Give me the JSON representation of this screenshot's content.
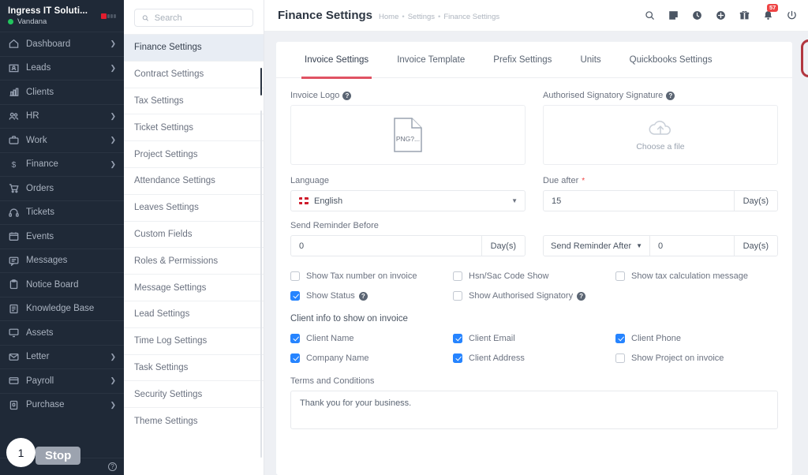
{
  "sidebar": {
    "brand": {
      "name": "Ingress IT Soluti...",
      "user": "Vandana",
      "logo_icon": "logo-mark"
    },
    "items": [
      {
        "label": "Dashboard",
        "icon": "home-icon",
        "chevron": true
      },
      {
        "label": "Leads",
        "icon": "id-card-icon",
        "chevron": true
      },
      {
        "label": "Clients",
        "icon": "bar-chart-icon",
        "chevron": false
      },
      {
        "label": "HR",
        "icon": "users-icon",
        "chevron": true
      },
      {
        "label": "Work",
        "icon": "briefcase-icon",
        "chevron": true
      },
      {
        "label": "Finance",
        "icon": "dollar-icon",
        "chevron": true
      },
      {
        "label": "Orders",
        "icon": "cart-icon",
        "chevron": false
      },
      {
        "label": "Tickets",
        "icon": "headset-icon",
        "chevron": false
      },
      {
        "label": "Events",
        "icon": "calendar-icon",
        "chevron": false
      },
      {
        "label": "Messages",
        "icon": "chat-icon",
        "chevron": false
      },
      {
        "label": "Notice Board",
        "icon": "clipboard-icon",
        "chevron": false
      },
      {
        "label": "Knowledge Base",
        "icon": "book-icon",
        "chevron": false
      },
      {
        "label": "Assets",
        "icon": "monitor-icon",
        "chevron": false
      },
      {
        "label": "Letter",
        "icon": "envelope-icon",
        "chevron": true
      },
      {
        "label": "Payroll",
        "icon": "wallet-icon",
        "chevron": true
      },
      {
        "label": "Purchase",
        "icon": "bag-icon",
        "chevron": true
      }
    ],
    "footer_icon": "help-icon"
  },
  "overlay": {
    "step_number": "1",
    "stop_label": "Stop"
  },
  "settings_nav": {
    "search": {
      "placeholder": "Search",
      "value": "",
      "icon": "search-icon"
    },
    "items": [
      "Finance Settings",
      "Contract Settings",
      "Tax Settings",
      "Ticket Settings",
      "Project Settings",
      "Attendance Settings",
      "Leaves Settings",
      "Custom Fields",
      "Roles & Permissions",
      "Message Settings",
      "Lead Settings",
      "Time Log Settings",
      "Task Settings",
      "Security Settings",
      "Theme Settings"
    ],
    "active": "Finance Settings"
  },
  "header": {
    "title": "Finance Settings",
    "breadcrumbs": [
      "Home",
      "Settings",
      "Finance Settings"
    ],
    "separator": "•",
    "icons": [
      {
        "name": "search-icon"
      },
      {
        "name": "note-icon"
      },
      {
        "name": "clock-icon"
      },
      {
        "name": "plus-circle-icon"
      },
      {
        "name": "gift-icon"
      },
      {
        "name": "bell-icon",
        "badge": "57"
      },
      {
        "name": "power-icon"
      }
    ]
  },
  "tabs": {
    "items": [
      "Invoice Settings",
      "Invoice Template",
      "Prefix Settings",
      "Units",
      "Quickbooks Settings"
    ],
    "active": "Invoice Settings",
    "highlighted": "Units"
  },
  "form": {
    "invoice_logo": {
      "label": "Invoice Logo",
      "help_icon": "question-icon",
      "file_badge": "PNG?...",
      "file_icon": "file-icon"
    },
    "signature": {
      "label": "Authorised Signatory Signature",
      "help_icon": "question-icon",
      "choose_text": "Choose a file",
      "upload_icon": "cloud-upload-icon"
    },
    "language": {
      "label": "Language",
      "value": "English",
      "flag_icon": "uk-flag-icon",
      "caret_icon": "chevron-down-icon"
    },
    "due_after": {
      "label": "Due after",
      "required": "*",
      "value": "15",
      "unit": "Day(s)"
    },
    "reminder_before": {
      "label": "Send Reminder Before",
      "value": "0",
      "unit": "Day(s)"
    },
    "reminder_after": {
      "select_label": "Send Reminder After",
      "caret_icon": "chevron-down-icon",
      "value": "0",
      "unit": "Day(s)"
    },
    "toggles": [
      [
        {
          "label": "Show Tax number on invoice",
          "checked": false,
          "help": false
        },
        {
          "label": "Hsn/Sac Code Show",
          "checked": false,
          "help": false
        },
        {
          "label": "Show tax calculation message",
          "checked": false,
          "help": false
        }
      ],
      [
        {
          "label": "Show Status",
          "checked": true,
          "help": true
        },
        {
          "label": "Show Authorised Signatory",
          "checked": false,
          "help": true
        },
        {
          "label": "",
          "checked": null,
          "help": false
        }
      ]
    ],
    "client_info": {
      "title": "Client info to show on invoice",
      "rows": [
        [
          {
            "label": "Client Name",
            "checked": true
          },
          {
            "label": "Client Email",
            "checked": true
          },
          {
            "label": "Client Phone",
            "checked": true
          }
        ],
        [
          {
            "label": "Company Name",
            "checked": true
          },
          {
            "label": "Client Address",
            "checked": true
          },
          {
            "label": "Show Project on invoice",
            "checked": false
          }
        ]
      ]
    },
    "terms": {
      "label": "Terms and Conditions",
      "value": "Thank you for your business."
    }
  },
  "colors": {
    "accent": "#e05263",
    "sidebar_bg": "#1f2937",
    "checkbox_on": "#2684ff",
    "badge": "#ef4444",
    "highlight": "#b2363f"
  }
}
